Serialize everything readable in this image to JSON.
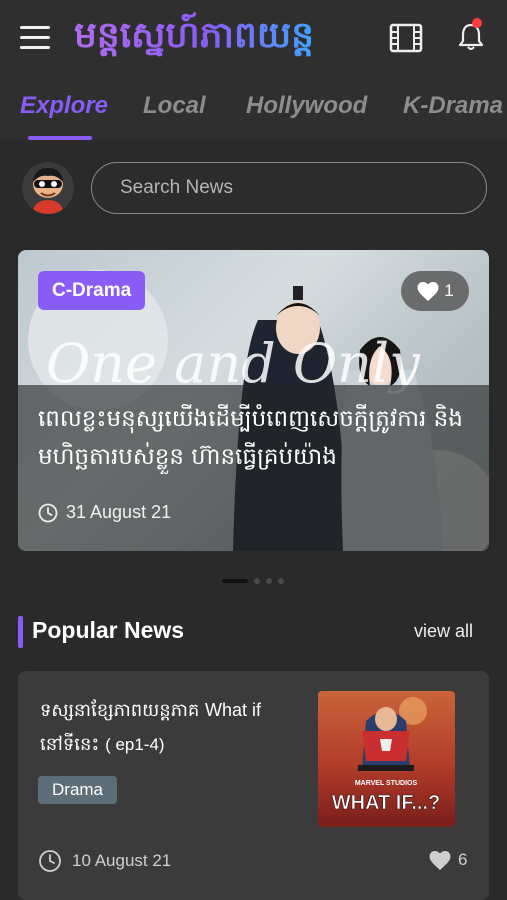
{
  "header": {
    "logo_text": "មន្តស្នេហ៍ភាពយន្ត"
  },
  "tabs": [
    {
      "label": "Explore"
    },
    {
      "label": "Local"
    },
    {
      "label": "Hollywood"
    },
    {
      "label": "K-Drama"
    }
  ],
  "search": {
    "placeholder": "Search News"
  },
  "banner": {
    "category": "C-Drama",
    "likes": "1",
    "title": "ពេលខ្លះមនុស្សយើងដើម្បីបំពេញសេចក្ដីត្រូវការ និងមហិច្ឆតារបស់ខ្លួន ហ៊ានធ្វើគ្រប់យ៉ាង",
    "date": "31 August 21",
    "art_text": "One and Only",
    "slide_index": 0,
    "slide_count": 4
  },
  "popular": {
    "title": "Popular News",
    "view_all": "view all"
  },
  "news": [
    {
      "title_km": "ទស្សនាខ្សែភាពយន្តភាគ",
      "title_en": "What if",
      "title_km2": "នៅទីនេះ",
      "episodes": "( ep1-4)",
      "tag": "Drama",
      "date": "10 August 21",
      "likes": "6",
      "thumb_text": "WHAT IF...?",
      "thumb_studio": "MARVEL STUDIOS"
    }
  ],
  "colors": {
    "accent": "#8a5cf6",
    "notification": "#ff3b3b"
  },
  "icons": [
    "menu-icon",
    "film-icon",
    "bell-icon",
    "heart-icon",
    "clock-icon"
  ]
}
